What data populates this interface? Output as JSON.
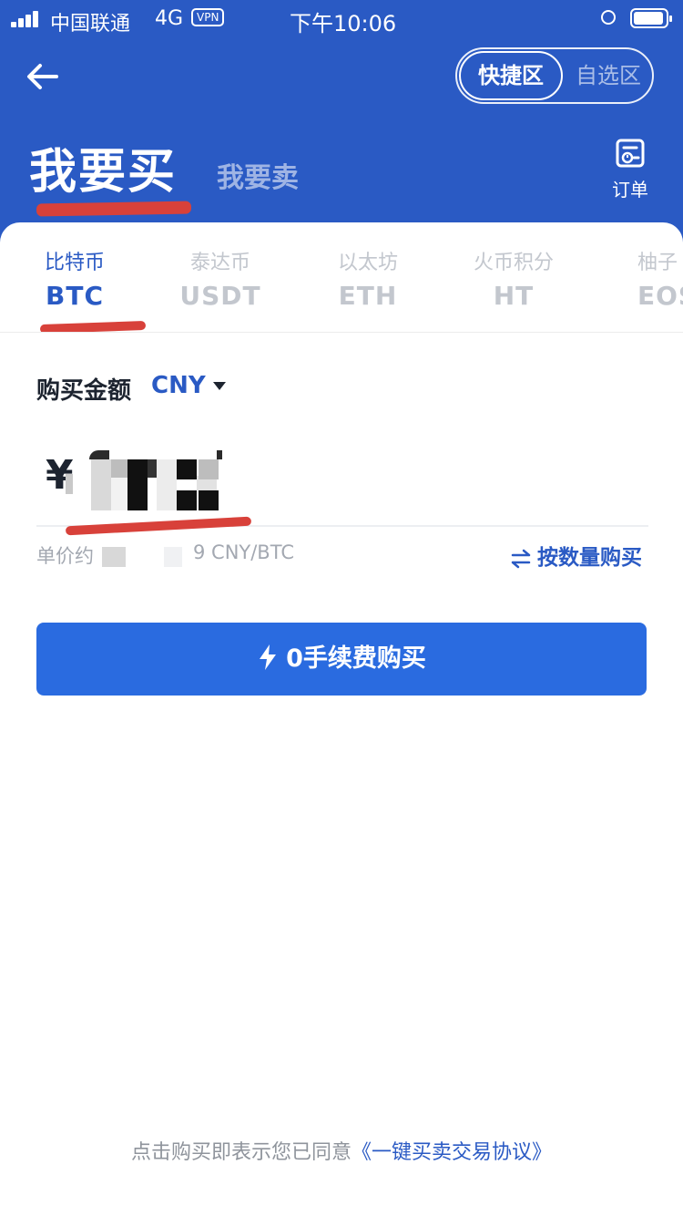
{
  "status_bar": {
    "carrier": "中国联通",
    "network": "4G",
    "vpn": "VPN",
    "time": "下午10:06"
  },
  "header": {
    "segment_active": "快捷区",
    "segment_inactive": "自选区",
    "title_buy": "我要买",
    "title_sell": "我要卖",
    "orders_label": "订单"
  },
  "coin_tabs": [
    {
      "cn": "比特币",
      "code": "BTC",
      "active": true
    },
    {
      "cn": "泰达币",
      "code": "USDT",
      "active": false
    },
    {
      "cn": "以太坊",
      "code": "ETH",
      "active": false
    },
    {
      "cn": "火币积分",
      "code": "HT",
      "active": false
    },
    {
      "cn": "柚子",
      "code": "EOS",
      "active": false
    }
  ],
  "purchase": {
    "amount_label": "购买金额",
    "currency": "CNY",
    "currency_symbol": "¥",
    "unit_price_label": "单价约",
    "unit_price_suffix": "9 CNY/BTC",
    "switch_mode_label": "按数量购买",
    "buy_button_label": "0手续费购买"
  },
  "footer": {
    "agreement_text": "点击购买即表示您已同意",
    "agreement_link": "《一键买卖交易协议》"
  },
  "colors": {
    "brand_blue": "#2a5ac4",
    "button_blue": "#2a6be0",
    "annotation_red": "#d8413a"
  }
}
